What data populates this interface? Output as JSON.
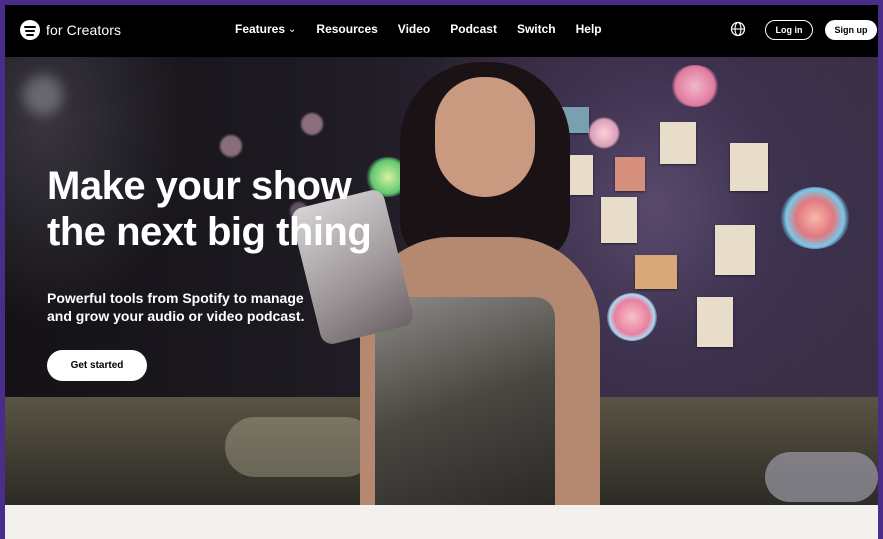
{
  "brand": {
    "logo_icon": "spotify-logo-icon",
    "text": "for Creators"
  },
  "nav": {
    "items": [
      {
        "label": "Features",
        "has_dropdown": true
      },
      {
        "label": "Resources"
      },
      {
        "label": "Video"
      },
      {
        "label": "Podcast"
      },
      {
        "label": "Switch"
      },
      {
        "label": "Help"
      }
    ],
    "globe_icon": "globe-icon",
    "login_label": "Log in",
    "signup_label": "Sign up"
  },
  "hero": {
    "headline_line1": "Make your show",
    "headline_line2": "the next big thing",
    "sub_line1": "Powerful tools from Spotify to manage",
    "sub_line2": "and grow your audio or video podcast.",
    "cta_label": "Get started"
  },
  "colors": {
    "frame": "#4a2c8a",
    "nav_bg": "#000000",
    "text": "#ffffff",
    "footer_strip": "#f3f1ee"
  }
}
